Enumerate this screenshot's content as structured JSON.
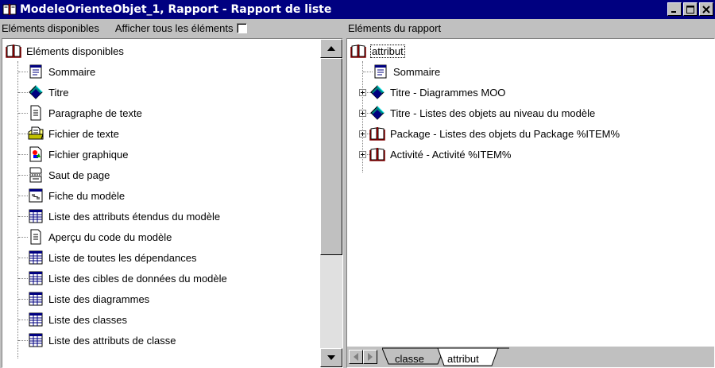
{
  "window": {
    "title": "ModeleOrienteObjet_1, Rapport - Rapport de liste",
    "buttons": {
      "minimize": "_",
      "maximize": "□",
      "close": "×"
    }
  },
  "left": {
    "header_label": "Eléments disponibles",
    "show_all_label": "Afficher tous les éléments",
    "show_all_checked": false,
    "root_label": "Eléments disponibles",
    "items": [
      {
        "label": "Sommaire",
        "icon": "summary-icon"
      },
      {
        "label": "Titre",
        "icon": "title-icon"
      },
      {
        "label": "Paragraphe de texte",
        "icon": "text-paragraph-icon"
      },
      {
        "label": "Fichier de texte",
        "icon": "text-file-icon"
      },
      {
        "label": "Fichier graphique",
        "icon": "graphic-file-icon"
      },
      {
        "label": "Saut de page",
        "icon": "page-break-icon"
      },
      {
        "label": "Fiche du modèle",
        "icon": "model-card-icon"
      },
      {
        "label": "Liste des attributs étendus du modèle",
        "icon": "list-icon"
      },
      {
        "label": "Aperçu du code du modèle",
        "icon": "code-preview-icon"
      },
      {
        "label": "Liste de toutes les dépendances",
        "icon": "list-icon"
      },
      {
        "label": "Liste des cibles de données du modèle",
        "icon": "list-icon"
      },
      {
        "label": "Liste des diagrammes",
        "icon": "list-icon"
      },
      {
        "label": "Liste des classes",
        "icon": "list-icon"
      },
      {
        "label": "Liste des attributs de classe",
        "icon": "list-icon"
      }
    ]
  },
  "right": {
    "header_label": "Eléments du rapport",
    "root_label": "attribut",
    "items": [
      {
        "label": "Sommaire",
        "icon": "summary-icon",
        "expandable": false
      },
      {
        "label": "Titre - Diagrammes MOO",
        "icon": "title-icon",
        "expandable": true
      },
      {
        "label": "Titre - Listes des objets au niveau du modèle",
        "icon": "title-icon",
        "expandable": true
      },
      {
        "label": "Package - Listes des objets du Package %ITEM%",
        "icon": "book-icon",
        "expandable": true
      },
      {
        "label": "Activité - Activité %ITEM%",
        "icon": "book-icon",
        "expandable": true
      }
    ],
    "tabs": [
      {
        "label": "classe",
        "active": false
      },
      {
        "label": "attribut",
        "active": true
      }
    ]
  }
}
